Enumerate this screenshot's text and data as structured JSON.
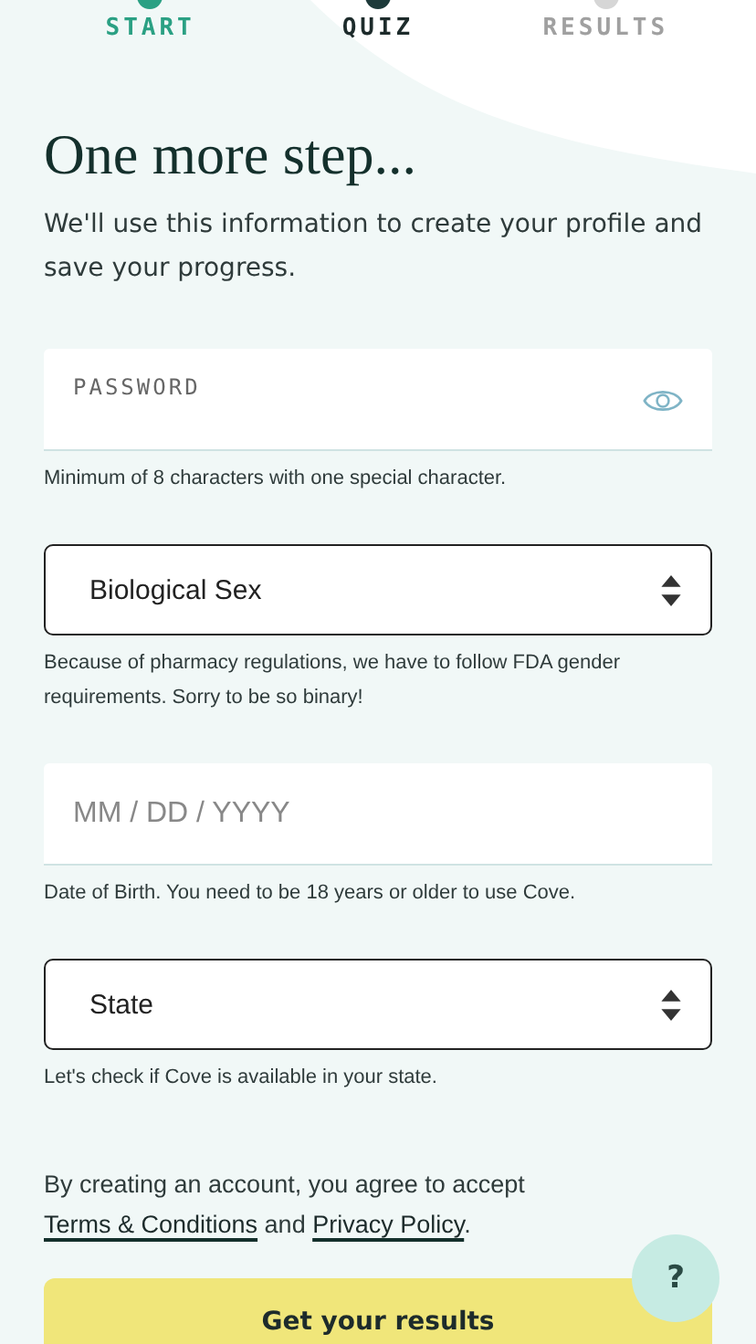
{
  "steps": [
    {
      "label": "START",
      "completed": true,
      "selected": false
    },
    {
      "label": "QUIZ",
      "completed": false,
      "selected": true
    },
    {
      "label": "RESULTS",
      "completed": false,
      "selected": false
    }
  ],
  "title": "One more step...",
  "intro": "We'll use this information to create your profile and save your progress.",
  "fields": [
    {
      "kind": "password",
      "placeholder": "PASSWORD",
      "hint": "Minimum of 8 characters with one special character."
    },
    {
      "kind": "select",
      "value": "Biological Sex",
      "hint": "Because of pharmacy regulations, we have to follow FDA gender requirements. Sorry to be so binary!"
    },
    {
      "kind": "date",
      "placeholder": "MM / DD / YYYY",
      "hint": "Date of Birth. You need to be 18 years or older to use Cove."
    },
    {
      "kind": "select",
      "value": "State",
      "hint": "Let's check if Cove is available in your state."
    }
  ],
  "consent": {
    "before": "By creating an account, you agree to accept ",
    "terms_link": "Terms & Conditions",
    "middle": " and ",
    "privacy_link": "Privacy Policy",
    "after": "."
  },
  "submit": "Get your results",
  "help": "?"
}
